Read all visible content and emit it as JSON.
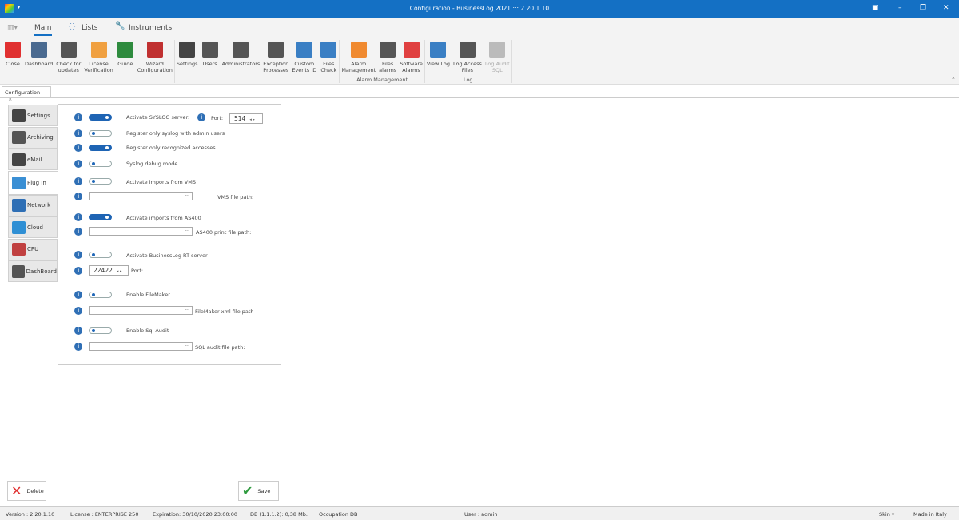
{
  "window": {
    "title": "Configuration - BusinessLog 2021 ::: 2.20.1.10"
  },
  "ribbon_tabs": [
    {
      "label": "Main"
    },
    {
      "label": "Lists"
    },
    {
      "label": "Instruments"
    }
  ],
  "ribbon_groups": [
    {
      "label": "",
      "buttons": [
        {
          "label": "Close",
          "icon": "close-icon",
          "color": "#e03030"
        },
        {
          "label": "Dashboard",
          "icon": "gauge-icon",
          "color": "#4a6a90"
        },
        {
          "label": "Check for\nupdates",
          "icon": "download-icon",
          "color": "#555555"
        },
        {
          "label": "License\nVerification",
          "icon": "clipboard-check-icon",
          "color": "#f0a040"
        },
        {
          "label": "Guide",
          "icon": "book-icon",
          "color": "#2e8b3e"
        },
        {
          "label": "Wizard\nConfiguration",
          "icon": "bookmark-icon",
          "color": "#c03030"
        }
      ]
    },
    {
      "label": "",
      "buttons": [
        {
          "label": "Settings",
          "icon": "gear-icon",
          "color": "#444444"
        },
        {
          "label": "Users",
          "icon": "users-icon",
          "color": "#555555"
        },
        {
          "label": "Administrators",
          "icon": "admin-key-icon",
          "color": "#555555"
        },
        {
          "label": "Exception\nProcesses",
          "icon": "checklist-icon",
          "color": "#555555"
        },
        {
          "label": "Custom\nEvents ID",
          "icon": "grid-search-icon",
          "color": "#3a7fc4"
        },
        {
          "label": "Files\nCheck",
          "icon": "file-search-icon",
          "color": "#3a7fc4"
        }
      ]
    },
    {
      "label": "Alarm Management",
      "buttons": [
        {
          "label": "Alarm\nManagement",
          "icon": "bell-icon",
          "color": "#f08a30"
        },
        {
          "label": "Files\nalarms",
          "icon": "file-lock-icon",
          "color": "#555555"
        },
        {
          "label": "Software\nAlarms",
          "icon": "calendar-icon",
          "color": "#e04040"
        }
      ]
    },
    {
      "label": "Log",
      "buttons": [
        {
          "label": "View Log",
          "icon": "grid-icon",
          "color": "#3a7fc4"
        },
        {
          "label": "Log Access\nFiles",
          "icon": "file-lock-icon",
          "color": "#555555"
        },
        {
          "label": "Log Audit\nSQL",
          "icon": "file-db-icon",
          "color": "#bbbbbb",
          "disabled": true
        }
      ]
    }
  ],
  "document_tab": {
    "label": "Configuration"
  },
  "side_tabs": [
    {
      "label": "Settings",
      "icon": "gear-icon"
    },
    {
      "label": "Archiving",
      "icon": "xml-icon"
    },
    {
      "label": "eMail",
      "icon": "envelope-icon"
    },
    {
      "label": "Plug In",
      "icon": "plugin-check-icon",
      "selected": true
    },
    {
      "label": "Network",
      "icon": "network-icon"
    },
    {
      "label": "Cloud",
      "icon": "cloud-icon"
    },
    {
      "label": "CPU",
      "icon": "cpu-gauge-icon"
    },
    {
      "label": "DashBoard",
      "icon": "window-icon"
    }
  ],
  "form": {
    "syslog": {
      "label": "Activate SYSLOG server:",
      "on": true,
      "port_label": "Port:",
      "port": "514"
    },
    "admin_only": {
      "label": "Register only syslog with admin users",
      "on": false
    },
    "recognized": {
      "label": "Register only recognized accesses",
      "on": true
    },
    "debug": {
      "label": "Syslog debug mode",
      "on": false
    },
    "vms": {
      "label": "Activate imports from VMS",
      "on": false,
      "path_label": "VMS file path:",
      "path": ""
    },
    "as400": {
      "label": "Activate imports from AS400",
      "on": true,
      "path_label": "AS400 print file path:",
      "path": ""
    },
    "rt": {
      "label": "Activate BusinessLog RT server",
      "on": false,
      "port_label": "Port:",
      "port": "22422"
    },
    "filemaker": {
      "label": "Enable FileMaker",
      "on": false,
      "path_label": "FileMaker xml file path",
      "path": ""
    },
    "sqlaudit": {
      "label": "Enable Sql Audit",
      "on": false,
      "path_label": "SQL audit file path:",
      "path": ""
    }
  },
  "buttons": {
    "delete": "Delete",
    "save": "Save"
  },
  "status": {
    "version": "Version : 2.20.1.10",
    "license": "License : ENTERPRISE 250",
    "expiration": "Expiration: 30/10/2020 23:00:00",
    "db": "DB (1.1.1.2): 0,38 Mb.",
    "occupation": "Occupation DB",
    "user": "User : admin",
    "skin": "Skin",
    "made": "Made in Italy"
  }
}
